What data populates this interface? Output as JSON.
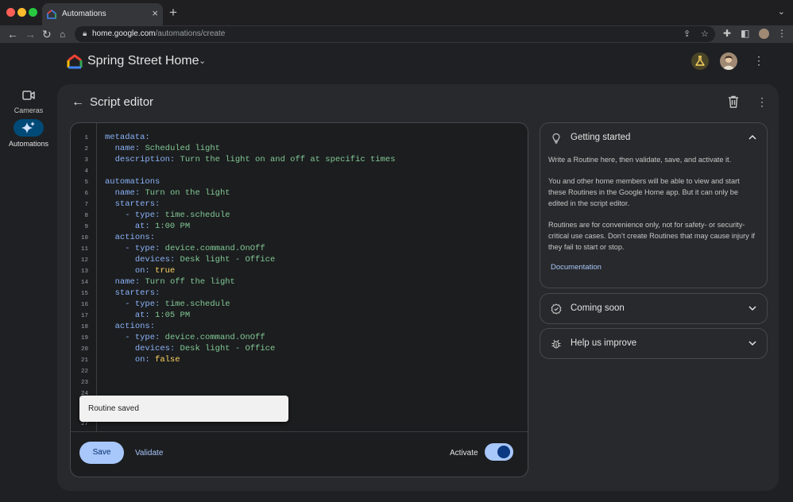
{
  "browser": {
    "tab_title": "Automations",
    "url_host": "home.google.com",
    "url_path": "/automations/create"
  },
  "header": {
    "home_name": "Spring Street Home"
  },
  "rail": {
    "items": [
      {
        "label": "Cameras",
        "icon": "videocam-icon"
      },
      {
        "label": "Automations",
        "icon": "sparkle-icon",
        "active": true
      }
    ]
  },
  "editor": {
    "title": "Script editor",
    "line_numbers": [
      "1",
      "2",
      "3",
      "4",
      "5",
      "6",
      "7",
      "8",
      "9",
      "10",
      "11",
      "12",
      "13",
      "14",
      "15",
      "16",
      "17",
      "18",
      "19",
      "20",
      "21",
      "22",
      "23",
      "24",
      "27"
    ],
    "code": {
      "l1_key": "metadata:",
      "l2_key": "name:",
      "l2_val": "Scheduled light",
      "l3_key": "description:",
      "l3_val": "Turn the light on and off at specific times",
      "l5_key": "automations",
      "l6_key": "name:",
      "l6_val": "Turn on the light",
      "l7_key": "starters:",
      "l8_key": "- type:",
      "l8_val": "time.schedule",
      "l9_key": "at:",
      "l9_val": "1:00 PM",
      "l10_key": "actions:",
      "l11_key": "- type:",
      "l11_val": "device.command.OnOff",
      "l12_key": "devices:",
      "l12_val": "Desk light - Office",
      "l13_key": "on:",
      "l13_val": "true",
      "l14_key": "name:",
      "l14_val": "Turn off the light",
      "l15_key": "starters:",
      "l16_key": "- type:",
      "l16_val": "time.schedule",
      "l17_key": "at:",
      "l17_val": "1:05 PM",
      "l18_key": "actions:",
      "l19_key": "- type:",
      "l19_val": "device.command.OnOff",
      "l20_key": "devices:",
      "l20_val": "Desk light - Office",
      "l21_key": "on:",
      "l21_val": "false"
    },
    "toast": "Routine saved",
    "save_label": "Save",
    "validate_label": "Validate",
    "activate_label": "Activate",
    "activate_on": true
  },
  "side": {
    "getting_started": {
      "title": "Getting started",
      "p1": "Write a Routine here, then validate, save, and activate it.",
      "p2": "You and other home members will be able to view and start these Routines in the Google Home app. But it can only be edited in the script editor.",
      "p3": "Routines are for convenience only, not for safety- or security-critical use cases. Don’t create Routines that may cause injury if they fail to start or stop.",
      "link": "Documentation"
    },
    "coming_soon": {
      "title": "Coming soon"
    },
    "help_improve": {
      "title": "Help us improve"
    }
  },
  "colors": {
    "accent": "#a8c7fa",
    "code_key": "#8ab4f8",
    "code_string": "#81c995",
    "code_value": "#fdd663",
    "active_pill": "#004a77"
  }
}
